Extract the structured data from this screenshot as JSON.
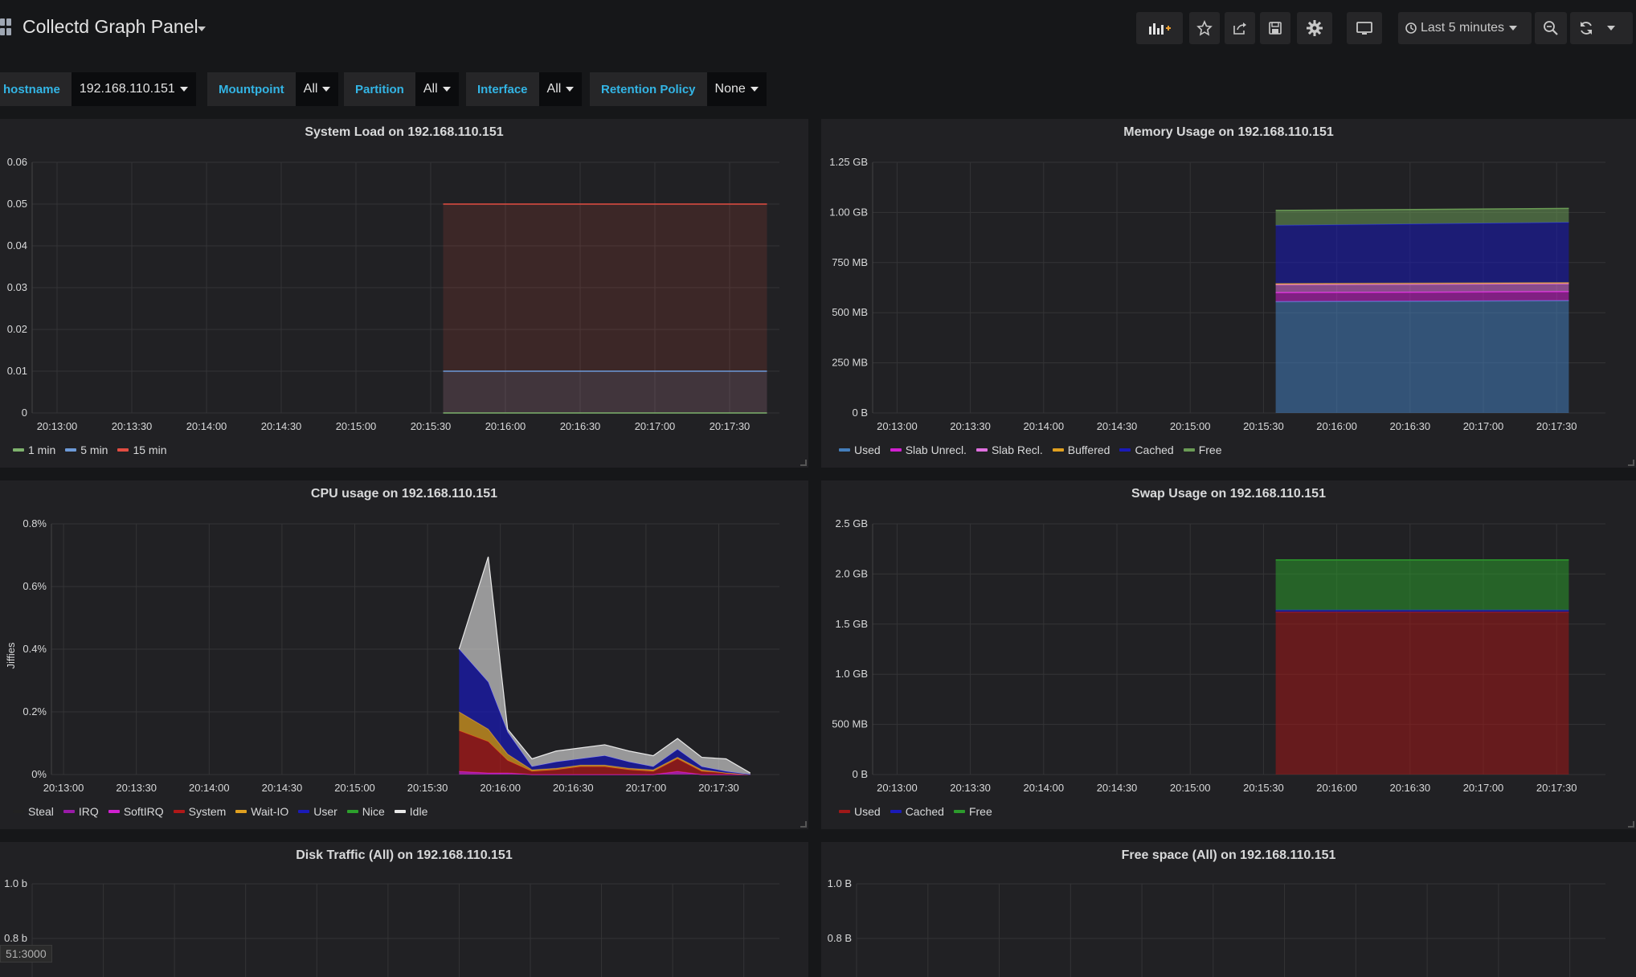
{
  "dashboard": {
    "title": "Collectd Graph Panel"
  },
  "toolbar": {
    "time_range": "Last 5 minutes",
    "icons": [
      "add-panel-icon",
      "star-icon",
      "share-icon",
      "save-icon",
      "settings-icon",
      "tv-mode-icon",
      "clock-icon",
      "zoom-out-icon",
      "refresh-icon",
      "chevron-down-icon"
    ]
  },
  "variables": [
    {
      "label": "hostname",
      "value": "192.168.110.151"
    },
    {
      "label": "Mountpoint",
      "value": "All"
    },
    {
      "label": "Partition",
      "value": "All"
    },
    {
      "label": "Interface",
      "value": "All"
    },
    {
      "label": "Retention Policy",
      "value": "None"
    }
  ],
  "colors": {
    "accent": "#33b5e5",
    "panel_bg": "#212124",
    "page_bg": "#161719",
    "grid": "#3a3a3a"
  },
  "status_bar": {
    "url": "51:3000"
  },
  "panels": {
    "system_load": {
      "title": "System Load on 192.168.110.151",
      "chart_data": {
        "type": "line",
        "x": [
          "20:13:00",
          "20:13:30",
          "20:14:00",
          "20:14:30",
          "20:15:00",
          "20:15:30",
          "20:16:00",
          "20:16:30",
          "20:17:00",
          "20:17:30"
        ],
        "y_ticks": [
          "0",
          "0.01",
          "0.02",
          "0.03",
          "0.04",
          "0.05",
          "0.06"
        ],
        "ylim": [
          0,
          0.06
        ],
        "xlim": [
          "20:12:50",
          "20:17:50"
        ],
        "series": [
          {
            "name": "1 min",
            "color": "#7eb26d",
            "points": [
              [
                "20:15:35",
                0
              ],
              [
                "20:17:45",
                0
              ]
            ]
          },
          {
            "name": "5 min",
            "color": "#6d9ad8",
            "points": [
              [
                "20:15:35",
                0.01
              ],
              [
                "20:17:45",
                0.01
              ]
            ]
          },
          {
            "name": "15 min",
            "color": "#e24d42",
            "points": [
              [
                "20:15:35",
                0.05
              ],
              [
                "20:17:45",
                0.05
              ]
            ]
          }
        ]
      }
    },
    "memory_usage": {
      "title": "Memory Usage on 192.168.110.151",
      "chart_data": {
        "type": "area",
        "stacked": true,
        "x": [
          "20:13:00",
          "20:13:30",
          "20:14:00",
          "20:14:30",
          "20:15:00",
          "20:15:30",
          "20:16:00",
          "20:16:30",
          "20:17:00",
          "20:17:30"
        ],
        "y_ticks": [
          "0 B",
          "250 MB",
          "500 MB",
          "750 MB",
          "1.00 GB",
          "1.25 GB"
        ],
        "ylim_mb": [
          0,
          1250
        ],
        "xlim": [
          "20:12:50",
          "20:17:50"
        ],
        "x_range": [
          "20:15:35",
          "20:17:35"
        ],
        "series": [
          {
            "name": "Used",
            "color": "#447ebc",
            "values_mb": [
              555,
              560
            ]
          },
          {
            "name": "Slab Unrecl.",
            "color": "#d020d0",
            "values_mb": [
              45,
              45
            ]
          },
          {
            "name": "Slab Recl.",
            "color": "#e070e0",
            "values_mb": [
              40,
              40
            ]
          },
          {
            "name": "Buffered",
            "color": "#e0a020",
            "values_mb": [
              5,
              5
            ]
          },
          {
            "name": "Cached",
            "color": "#1a1ab8",
            "values_mb": [
              290,
              300
            ]
          },
          {
            "name": "Free",
            "color": "#6a9b55",
            "values_mb": [
              75,
              70
            ]
          }
        ]
      }
    },
    "cpu_usage": {
      "title": "CPU usage on 192.168.110.151",
      "chart_data": {
        "type": "area",
        "stacked": true,
        "ylabel": "Jiffies",
        "x": [
          "20:13:00",
          "20:13:30",
          "20:14:00",
          "20:14:30",
          "20:15:00",
          "20:15:30",
          "20:16:00",
          "20:16:30",
          "20:17:00",
          "20:17:30"
        ],
        "y_ticks": [
          "0%",
          "0.2%",
          "0.4%",
          "0.6%",
          "0.8%"
        ],
        "ylim": [
          0,
          0.8
        ],
        "xlim": [
          "20:12:55",
          "20:17:55"
        ],
        "time_points": [
          "20:15:43",
          "20:15:55",
          "20:16:03",
          "20:16:13",
          "20:16:23",
          "20:16:33",
          "20:16:43",
          "20:16:53",
          "20:17:03",
          "20:17:13",
          "20:17:23",
          "20:17:33",
          "20:17:43"
        ],
        "series": [
          {
            "name": "Steal",
            "color": "#222222",
            "values": [
              0,
              0,
              0,
              0,
              0,
              0,
              0,
              0,
              0,
              0,
              0,
              0,
              0
            ]
          },
          {
            "name": "IRQ",
            "color": "#9a1aa8",
            "values": [
              0,
              0,
              0,
              0,
              0,
              0,
              0,
              0,
              0,
              0,
              0,
              0,
              0
            ]
          },
          {
            "name": "SoftIRQ",
            "color": "#d020d0",
            "values": [
              0.01,
              0.005,
              0.005,
              0,
              0,
              0,
              0,
              0,
              0,
              0.01,
              0,
              0,
              0
            ]
          },
          {
            "name": "System",
            "color": "#b01818",
            "values": [
              0.13,
              0.1,
              0.04,
              0.01,
              0.015,
              0.025,
              0.025,
              0.015,
              0.01,
              0.04,
              0.01,
              0.005,
              0
            ]
          },
          {
            "name": "Wait-IO",
            "color": "#e0a020",
            "values": [
              0.06,
              0.04,
              0.02,
              0.005,
              0.005,
              0.005,
              0.005,
              0.005,
              0.005,
              0.005,
              0.005,
              0,
              0
            ]
          },
          {
            "name": "User",
            "color": "#1a1ab8",
            "values": [
              0.2,
              0.15,
              0.07,
              0.01,
              0.02,
              0.02,
              0.03,
              0.02,
              0.01,
              0.025,
              0.01,
              0.005,
              0
            ]
          },
          {
            "name": "Nice",
            "color": "#2ca02c",
            "values": [
              0,
              0,
              0,
              0,
              0,
              0,
              0,
              0,
              0,
              0,
              0,
              0,
              0
            ]
          },
          {
            "name": "Idle",
            "color": "#e8e8e8",
            "values": [
              0,
              0.4,
              0.01,
              0.025,
              0.035,
              0.035,
              0.035,
              0.035,
              0.035,
              0.035,
              0.03,
              0.04,
              0.005
            ]
          }
        ]
      }
    },
    "swap_usage": {
      "title": "Swap Usage on 192.168.110.151",
      "chart_data": {
        "type": "area",
        "stacked": true,
        "x": [
          "20:13:00",
          "20:13:30",
          "20:14:00",
          "20:14:30",
          "20:15:00",
          "20:15:30",
          "20:16:00",
          "20:16:30",
          "20:17:00",
          "20:17:30"
        ],
        "y_ticks": [
          "0 B",
          "500 MB",
          "1.0 GB",
          "1.5 GB",
          "2.0 GB",
          "2.5 GB"
        ],
        "ylim_gb": [
          0,
          2.5
        ],
        "xlim": [
          "20:12:50",
          "20:17:50"
        ],
        "x_range": [
          "20:15:35",
          "20:17:35"
        ],
        "series": [
          {
            "name": "Used",
            "color": "#a01818",
            "values_gb": [
              1.62,
              1.62
            ]
          },
          {
            "name": "Cached",
            "color": "#1a1ab8",
            "values_gb": [
              0.02,
              0.02
            ]
          },
          {
            "name": "Free",
            "color": "#2c9a2c",
            "values_gb": [
              0.5,
              0.5
            ]
          }
        ]
      }
    },
    "disk_traffic": {
      "title": "Disk Traffic (All) on 192.168.110.151",
      "chart_data": {
        "type": "line",
        "y_ticks": [
          "0.8 b",
          "1.0 b"
        ],
        "series": []
      }
    },
    "free_space": {
      "title": "Free space (All) on 192.168.110.151",
      "chart_data": {
        "type": "line",
        "y_ticks": [
          "0.8 B",
          "1.0 B"
        ],
        "series": []
      }
    }
  }
}
